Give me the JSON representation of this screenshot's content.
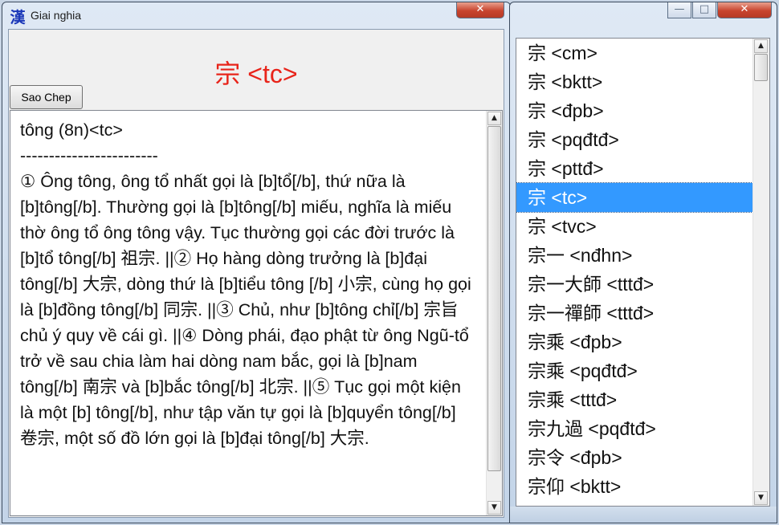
{
  "left_window": {
    "app_icon_glyph": "漢",
    "title": "Giai nghia",
    "close_glyph": "✕",
    "heading": "宗 <tc>",
    "copy_button": "Sao Chep",
    "body_text": "tông (8n)<tc>\n------------------------\n① Ông tông, ông tổ nhất gọi là [b]tổ[/b], thứ nữa là [b]tông[/b]. Thường gọi là [b]tông[/b] miếu, nghĩa là miếu thờ ông tổ ông tông vậy. Tục thường gọi các đời trước là [b]tổ tông[/b] 祖宗. ||② Họ hàng dòng trưởng là [b]đại tông[/b] 大宗, dòng thứ là [b]tiểu tông [/b] 小宗, cùng họ gọi là [b]đồng tông[/b] 同宗. ||③ Chủ, như [b]tông chỉ[/b] 宗旨 chủ ý quy về cái gì. ||④ Dòng phái, đạo phật từ ông Ngũ-tổ trở về sau chia làm hai dòng nam bắc, gọi là [b]nam tông[/b] 南宗 và [b]bắc tông[/b] 北宗. ||⑤ Tục gọi một kiện là một [b] tông[/b], như tập văn tự gọi là [b]quyển tông[/b] 卷宗, một số đồ lớn gọi là [b]đại tông[/b] 大宗."
  },
  "right_window": {
    "controls": {
      "minimize": "—",
      "maximize": "□",
      "close": "✕"
    },
    "selected_index": 5,
    "items": [
      "宗  <cm>",
      "宗 <bktt>",
      "宗 <đpb>",
      "宗 <pqđtđ>",
      "宗 <pttđ>",
      "宗 <tc>",
      "宗 <tvc>",
      "宗一 <nđhn>",
      "宗一大師 <tttđ>",
      "宗一禪師 <tttđ>",
      "宗乘 <đpb>",
      "宗乘 <pqđtđ>",
      "宗乘 <tttđ>",
      "宗九過 <pqđtđ>",
      "宗令 <đpb>",
      "宗仰 <bktt>"
    ]
  },
  "scroll_arrows": {
    "up": "▲",
    "down": "▼"
  },
  "colors": {
    "heading": "#e8241a",
    "selection": "#3399ff",
    "close_button": "#c8442e"
  }
}
